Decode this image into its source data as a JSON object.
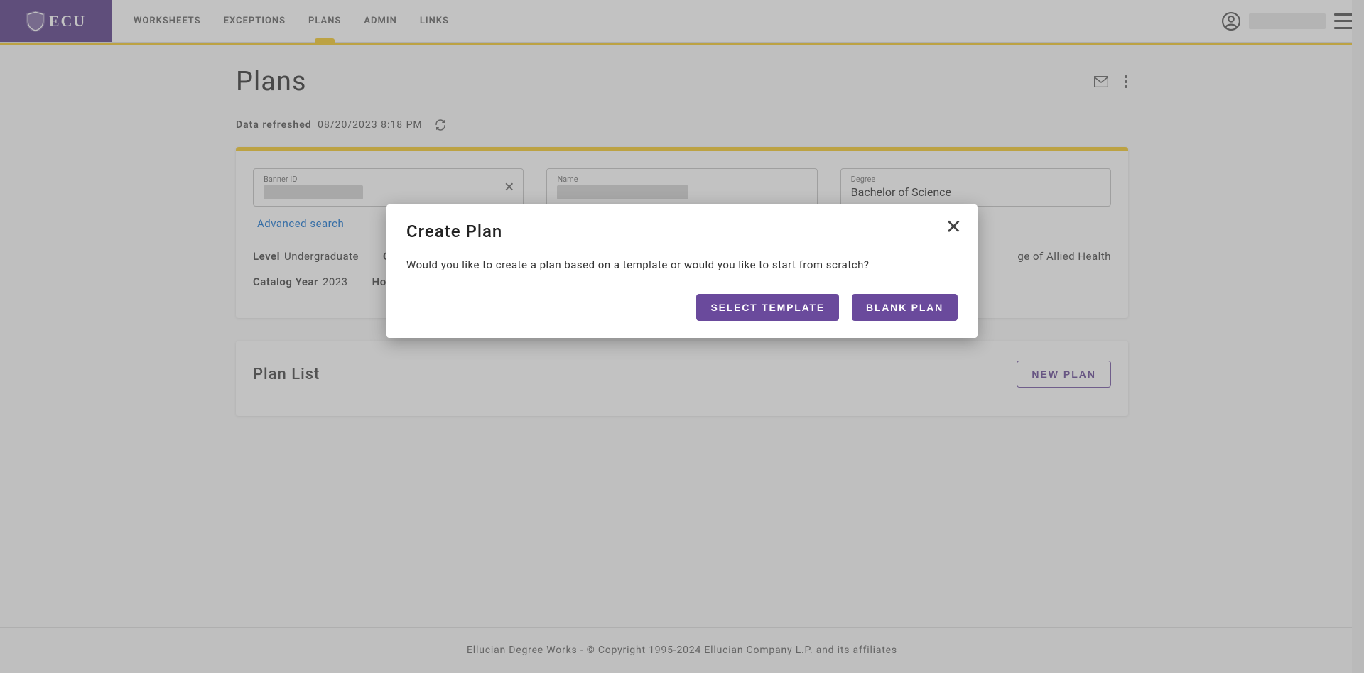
{
  "logo_text": "ECU",
  "nav": {
    "items": [
      {
        "label": "WORKSHEETS",
        "active": false
      },
      {
        "label": "EXCEPTIONS",
        "active": false
      },
      {
        "label": "PLANS",
        "active": true
      },
      {
        "label": "ADMIN",
        "active": false
      },
      {
        "label": "LINKS",
        "active": false
      }
    ]
  },
  "page_title": "Plans",
  "refresh": {
    "label": "Data refreshed",
    "timestamp": "08/20/2023 8:18 PM"
  },
  "fields": {
    "banner_id": {
      "label": "Banner ID",
      "value": ""
    },
    "name": {
      "label": "Name",
      "value": ""
    },
    "degree": {
      "label": "Degree",
      "value": "Bachelor of Science"
    }
  },
  "advanced_search": "Advanced search",
  "meta": {
    "level": {
      "label": "Level",
      "value": "Undergraduate"
    },
    "classification": {
      "label": "Cla",
      "value": ""
    },
    "program": {
      "label": "",
      "value": "ge of Allied Health"
    },
    "catalog_year": {
      "label": "Catalog Year",
      "value": "2023"
    },
    "holds": {
      "label": "Holds",
      "value": ""
    }
  },
  "plan_list": {
    "title": "Plan List",
    "new_plan_button": "NEW PLAN"
  },
  "modal": {
    "title": "Create Plan",
    "body": "Would you like to create a plan based on a template or would you like to start from scratch?",
    "select_template_btn": "SELECT TEMPLATE",
    "blank_plan_btn": "BLANK PLAN"
  },
  "footer": "Ellucian Degree Works - © Copyright 1995-2024 Ellucian Company L.P. and its affiliates"
}
